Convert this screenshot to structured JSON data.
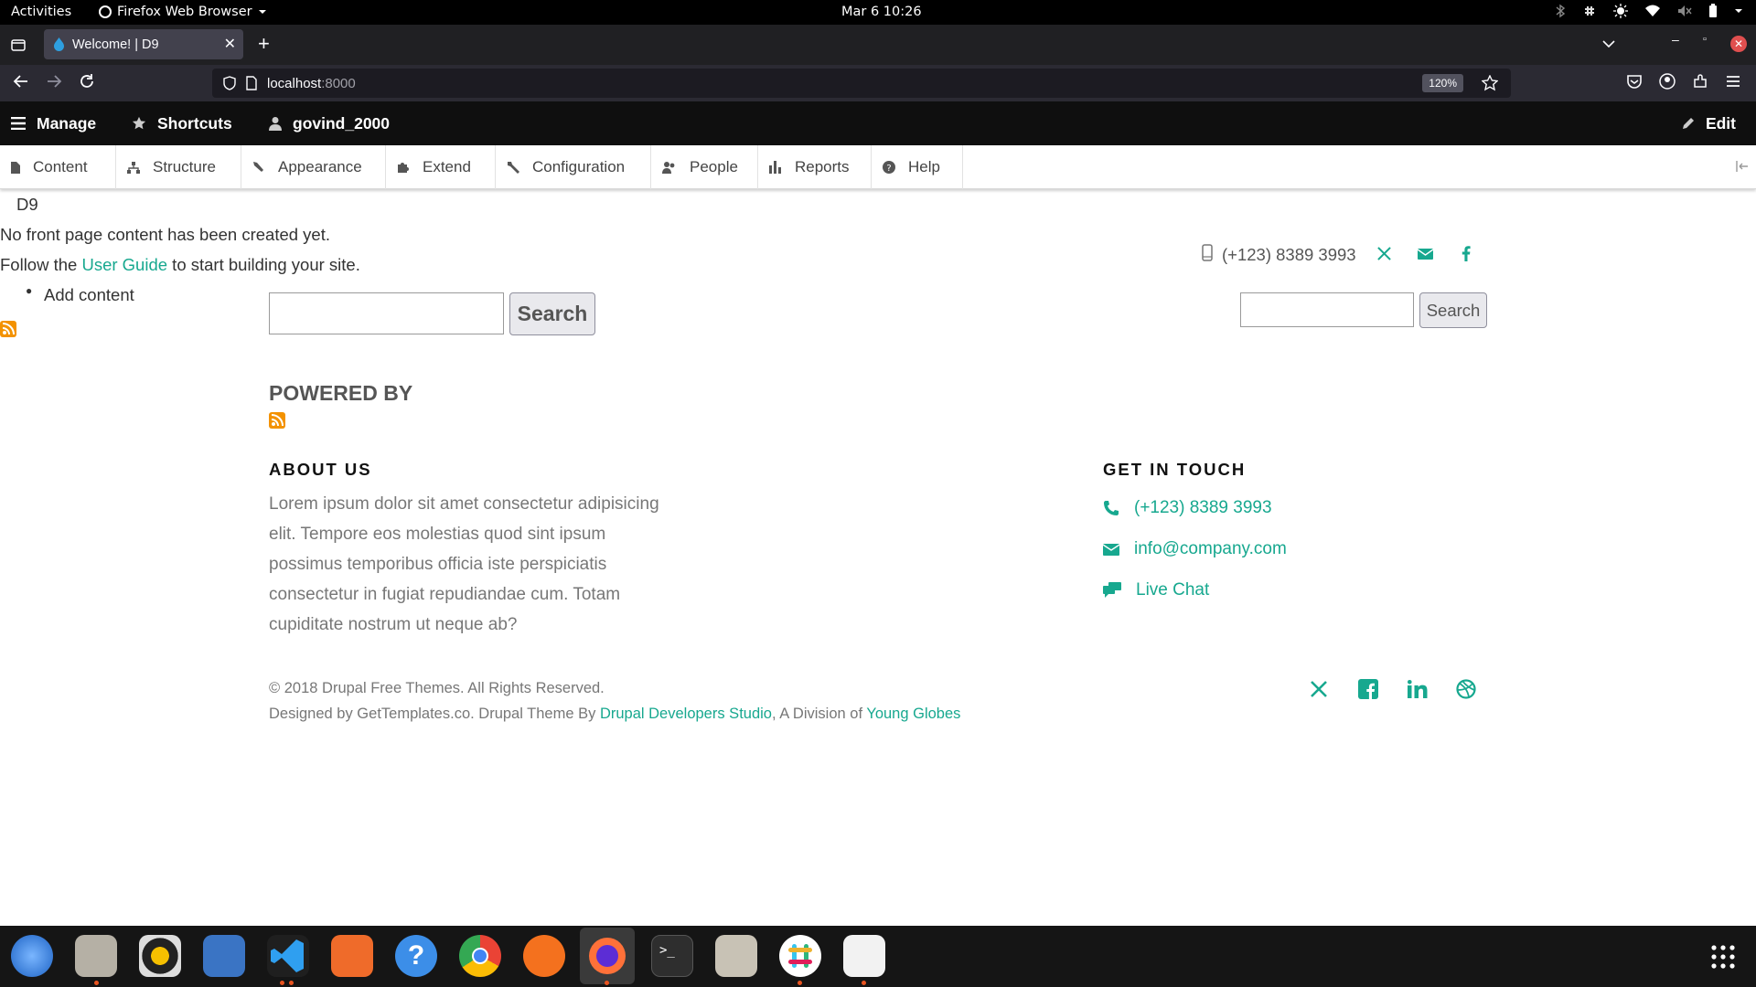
{
  "system_bar": {
    "activities": "Activities",
    "app_name": "Firefox Web Browser",
    "clock": "Mar 6  10:26"
  },
  "browser": {
    "tab_title": "Welcome! | D9",
    "url_host": "localhost",
    "url_port": ":8000",
    "zoom": "120%"
  },
  "toolbar": {
    "manage": "Manage",
    "shortcuts": "Shortcuts",
    "user": "govind_2000",
    "edit": "Edit",
    "tray": [
      "Content",
      "Structure",
      "Appearance",
      "Extend",
      "Configuration",
      "People",
      "Reports",
      "Help"
    ]
  },
  "page": {
    "site_name": "D9",
    "no_content": "No front page content has been created yet.",
    "follow_pre": "Follow the ",
    "follow_link": "User Guide",
    "follow_post": " to start building your site.",
    "add_content": "Add content",
    "header_phone": "(+123) 8389 3993",
    "search_button_large": "Search",
    "search_button_small": "Search",
    "powered_by": "POWERED BY",
    "about_heading": "ABOUT US",
    "about_text": "Lorem ipsum dolor sit amet consectetur adipisicing elit. Tempore eos molestias quod sint ipsum possimus temporibus officia iste perspiciatis consectetur in fugiat repudiandae cum. Totam cupiditate nostrum ut neque ab?",
    "contact_heading": "GET IN TOUCH",
    "contact_phone": "(+123) 8389 3993",
    "contact_email": "info@company.com",
    "contact_chat": "Live Chat",
    "copyright": "© 2018 Drupal Free Themes. All Rights Reserved.",
    "designed_pre": "Designed by GetTemplates.co. Drupal Theme By ",
    "designed_link1": "Drupal Developers Studio",
    "designed_mid": ", A Division of ",
    "designed_link2": "Young Globes"
  },
  "colors": {
    "accent": "#17a88f",
    "toolbar": "#0f0f0f",
    "rss": "#f39200"
  }
}
